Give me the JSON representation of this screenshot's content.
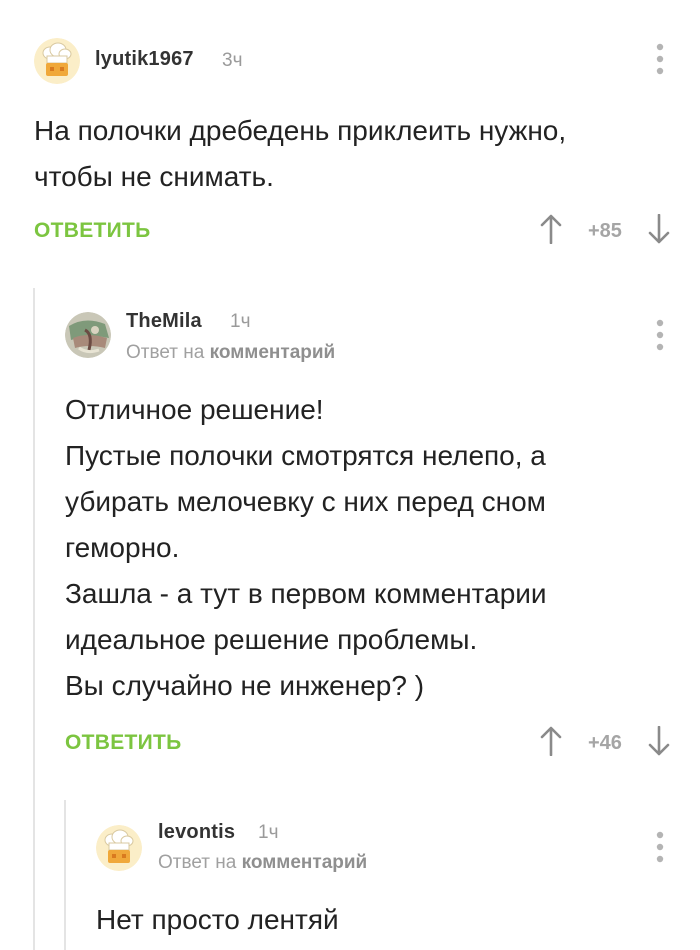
{
  "comments": [
    {
      "username": "lyutik1967",
      "time": "3ч",
      "text_lines": [
        "На полочки дребедень приклеить нужно,",
        "чтобы не снимать."
      ],
      "reply_label": "ОТВЕТИТЬ",
      "score": "+85",
      "avatar": "chef-hat-avatar-icon"
    },
    {
      "username": "TheMila",
      "time": "1ч",
      "reply_prefix": "Ответ на",
      "reply_link": "комментарий",
      "text_lines": [
        "Отличное решение!",
        "Пустые полочки смотрятся нелепо, а",
        "убирать мелочевку с них перед сном",
        "геморно.",
        "Зашла - а тут в первом комментарии",
        "идеальное решение проблемы.",
        "Вы случайно не инженер? )"
      ],
      "reply_label": "ОТВЕТИТЬ",
      "score": "+46",
      "avatar": "photo-avatar"
    },
    {
      "username": "levontis",
      "time": "1ч",
      "reply_prefix": "Ответ на",
      "reply_link": "комментарий",
      "text_lines": [
        "Нет просто лентяй"
      ],
      "avatar": "chef-hat-avatar-icon"
    }
  ],
  "colors": {
    "accent_green": "#7cc540",
    "muted_gray": "#9a9a9a",
    "thread_line": "#e4e4e4"
  },
  "icons": {
    "menu": "vertical-dots-icon",
    "upvote": "arrow-up-icon",
    "downvote": "arrow-down-icon"
  }
}
